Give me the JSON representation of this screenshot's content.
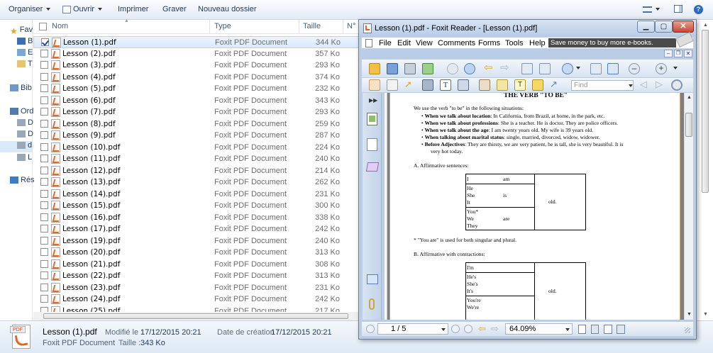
{
  "explorer": {
    "toolbar": {
      "organize": "Organiser",
      "open": "Ouvrir",
      "print": "Imprimer",
      "burn": "Graver",
      "new_folder": "Nouveau dossier"
    },
    "nav": [
      "Fav",
      "Bi",
      "E",
      "T",
      "Bib",
      "Ord",
      "D",
      "D",
      "d",
      "L",
      "Rés"
    ],
    "columns": {
      "name": "Nom",
      "type": "Type",
      "size": "Taille",
      "num": "N°"
    },
    "files": [
      {
        "name": "Lesson  (1).pdf",
        "type": "Foxit PDF Document",
        "size": "344 Ko",
        "selected": true
      },
      {
        "name": "Lesson  (2).pdf",
        "type": "Foxit PDF Document",
        "size": "357 Ko"
      },
      {
        "name": "Lesson  (3).pdf",
        "type": "Foxit PDF Document",
        "size": "293 Ko"
      },
      {
        "name": "Lesson  (4).pdf",
        "type": "Foxit PDF Document",
        "size": "374 Ko"
      },
      {
        "name": "Lesson  (5).pdf",
        "type": "Foxit PDF Document",
        "size": "232 Ko"
      },
      {
        "name": "Lesson  (6).pdf",
        "type": "Foxit PDF Document",
        "size": "343 Ko"
      },
      {
        "name": "Lesson  (7).pdf",
        "type": "Foxit PDF Document",
        "size": "293 Ko"
      },
      {
        "name": "Lesson  (8).pdf",
        "type": "Foxit PDF Document",
        "size": "259 Ko"
      },
      {
        "name": "Lesson  (9).pdf",
        "type": "Foxit PDF Document",
        "size": "287 Ko"
      },
      {
        "name": "Lesson  (10).pdf",
        "type": "Foxit PDF Document",
        "size": "224 Ko"
      },
      {
        "name": "Lesson  (11).pdf",
        "type": "Foxit PDF Document",
        "size": "240 Ko"
      },
      {
        "name": "Lesson  (12).pdf",
        "type": "Foxit PDF Document",
        "size": "214 Ko"
      },
      {
        "name": "Lesson  (13).pdf",
        "type": "Foxit PDF Document",
        "size": "262 Ko"
      },
      {
        "name": "Lesson  (14).pdf",
        "type": "Foxit PDF Document",
        "size": "231 Ko"
      },
      {
        "name": "Lesson  (15).pdf",
        "type": "Foxit PDF Document",
        "size": "300 Ko"
      },
      {
        "name": "Lesson  (16).pdf",
        "type": "Foxit PDF Document",
        "size": "338 Ko"
      },
      {
        "name": "Lesson  (17).pdf",
        "type": "Foxit PDF Document",
        "size": "242 Ko"
      },
      {
        "name": "Lesson  (19).pdf",
        "type": "Foxit PDF Document",
        "size": "240 Ko"
      },
      {
        "name": "Lesson  (20).pdf",
        "type": "Foxit PDF Document",
        "size": "313 Ko"
      },
      {
        "name": "Lesson  (21).pdf",
        "type": "Foxit PDF Document",
        "size": "308 Ko"
      },
      {
        "name": "Lesson  (22).pdf",
        "type": "Foxit PDF Document",
        "size": "313 Ko"
      },
      {
        "name": "Lesson  (23).pdf",
        "type": "Foxit PDF Document",
        "size": "231 Ko"
      },
      {
        "name": "Lesson  (24).pdf",
        "type": "Foxit PDF Document",
        "size": "242 Ko"
      },
      {
        "name": "Lesson  (25).pdf",
        "type": "Foxit PDF Document",
        "size": "217 Ko"
      }
    ],
    "details": {
      "icon_label": "PDF",
      "name": "Lesson  (1).pdf",
      "modified_label": "Modifié le :",
      "modified": "17/12/2015 20:21",
      "created_label": "Date de création :",
      "created": "17/12/2015 20:21",
      "type": "Foxit PDF Document",
      "size_label": "Taille :",
      "size": "343 Ko"
    }
  },
  "foxit": {
    "title": "Lesson  (1).pdf - Foxit Reader - [Lesson  (1).pdf]",
    "menu": [
      "File",
      "Edit",
      "View",
      "Comments",
      "Forms",
      "Tools",
      "Help"
    ],
    "ad_banner": "Save money to buy more e-books.",
    "find_placeholder": "Find",
    "page_indicator": "1 / 5",
    "zoom": "64.09%",
    "document": {
      "heading": "THE VERB \"TO BE\"",
      "intro": "We use the verb \"to be\" in the following situations:",
      "bullets": [
        {
          "bold": "When we talk about location",
          "text": ": In California, from Brazil, at home, in the park, etc."
        },
        {
          "bold": "When we talk about professions",
          "text": ": She is a teacher. He is doctor. They are police officers."
        },
        {
          "bold": "When we talk about the age",
          "text": ": I am twenty years old. My wife is 39 years old."
        },
        {
          "bold": "When talking about marital status",
          "text": ": single, married, divorced, widow, widower."
        },
        {
          "bold": "Before Adjectives",
          "text": ": They are thirsty, we are very patient, he is tall, she is very beautiful. It is"
        }
      ],
      "bullet_cont": "very hot today.",
      "section_a": "A. Affirmative sentences:",
      "table_a": {
        "row1": {
          "pronoun": "I",
          "verb": "am"
        },
        "row2": {
          "pronouns": [
            "He",
            "She",
            "It"
          ],
          "verb": "is"
        },
        "row3": {
          "pronouns": [
            "You*",
            "We",
            "They"
          ],
          "verb": "are"
        },
        "complement": "old."
      },
      "note": "* \"You are\" is used for both singular and plural.",
      "section_b": "B. Affirmative with contractions:",
      "table_b": {
        "row1": [
          "I'm"
        ],
        "row2": [
          "He's",
          "She's",
          "It's"
        ],
        "row3": [
          "You're",
          "We're"
        ],
        "complement": "old."
      }
    }
  }
}
